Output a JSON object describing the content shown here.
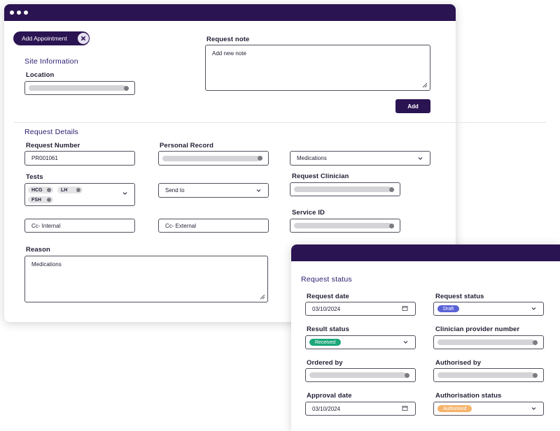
{
  "main_window": {
    "add_appointment_label": "Add Appointment",
    "site_information": {
      "title": "Site Information",
      "location_label": "Location"
    },
    "request_note": {
      "label": "Request note",
      "placeholder": "Add new note",
      "add_button": "Add"
    },
    "request_details": {
      "title": "Request Details",
      "request_number_label": "Request Number",
      "request_number_value": "PR001061",
      "personal_record_label": "Personal Record",
      "medications_value": "Medications",
      "tests_label": "Tests",
      "tests": [
        "HCG",
        "LH",
        "FSH"
      ],
      "send_to_value": "Send to",
      "request_clinician_label": "Request Clinician",
      "cc_internal_value": "Cc- Internal",
      "cc_external_value": "Cc- External",
      "service_id_label": "Service ID",
      "reason_label": "Reason",
      "reason_value": "Medications"
    }
  },
  "status_window": {
    "title": "Request status",
    "request_date_label": "Request date",
    "request_date_value": "03/10/2024",
    "request_status_label": "Request status",
    "request_status_value": "Draft",
    "result_status_label": "Result status",
    "result_status_value": "Received",
    "clinician_provider_label": "Clinician provider number",
    "ordered_by_label": "Ordered by",
    "authorised_by_label": "Authorised by",
    "approval_date_label": "Approval date",
    "approval_date_value": "03/10/2024",
    "authorisation_status_label": "Authorisation status",
    "authorisation_status_value": "Authorised"
  },
  "colors": {
    "brand": "#2b1452",
    "draft_badge": "#5a62d6",
    "received_badge": "#1ba77a",
    "authorised_badge": "#f5b46c"
  },
  "icons": [
    "close-icon",
    "chevron-down-icon",
    "calendar-icon",
    "clear-icon",
    "resize-handle-icon"
  ]
}
